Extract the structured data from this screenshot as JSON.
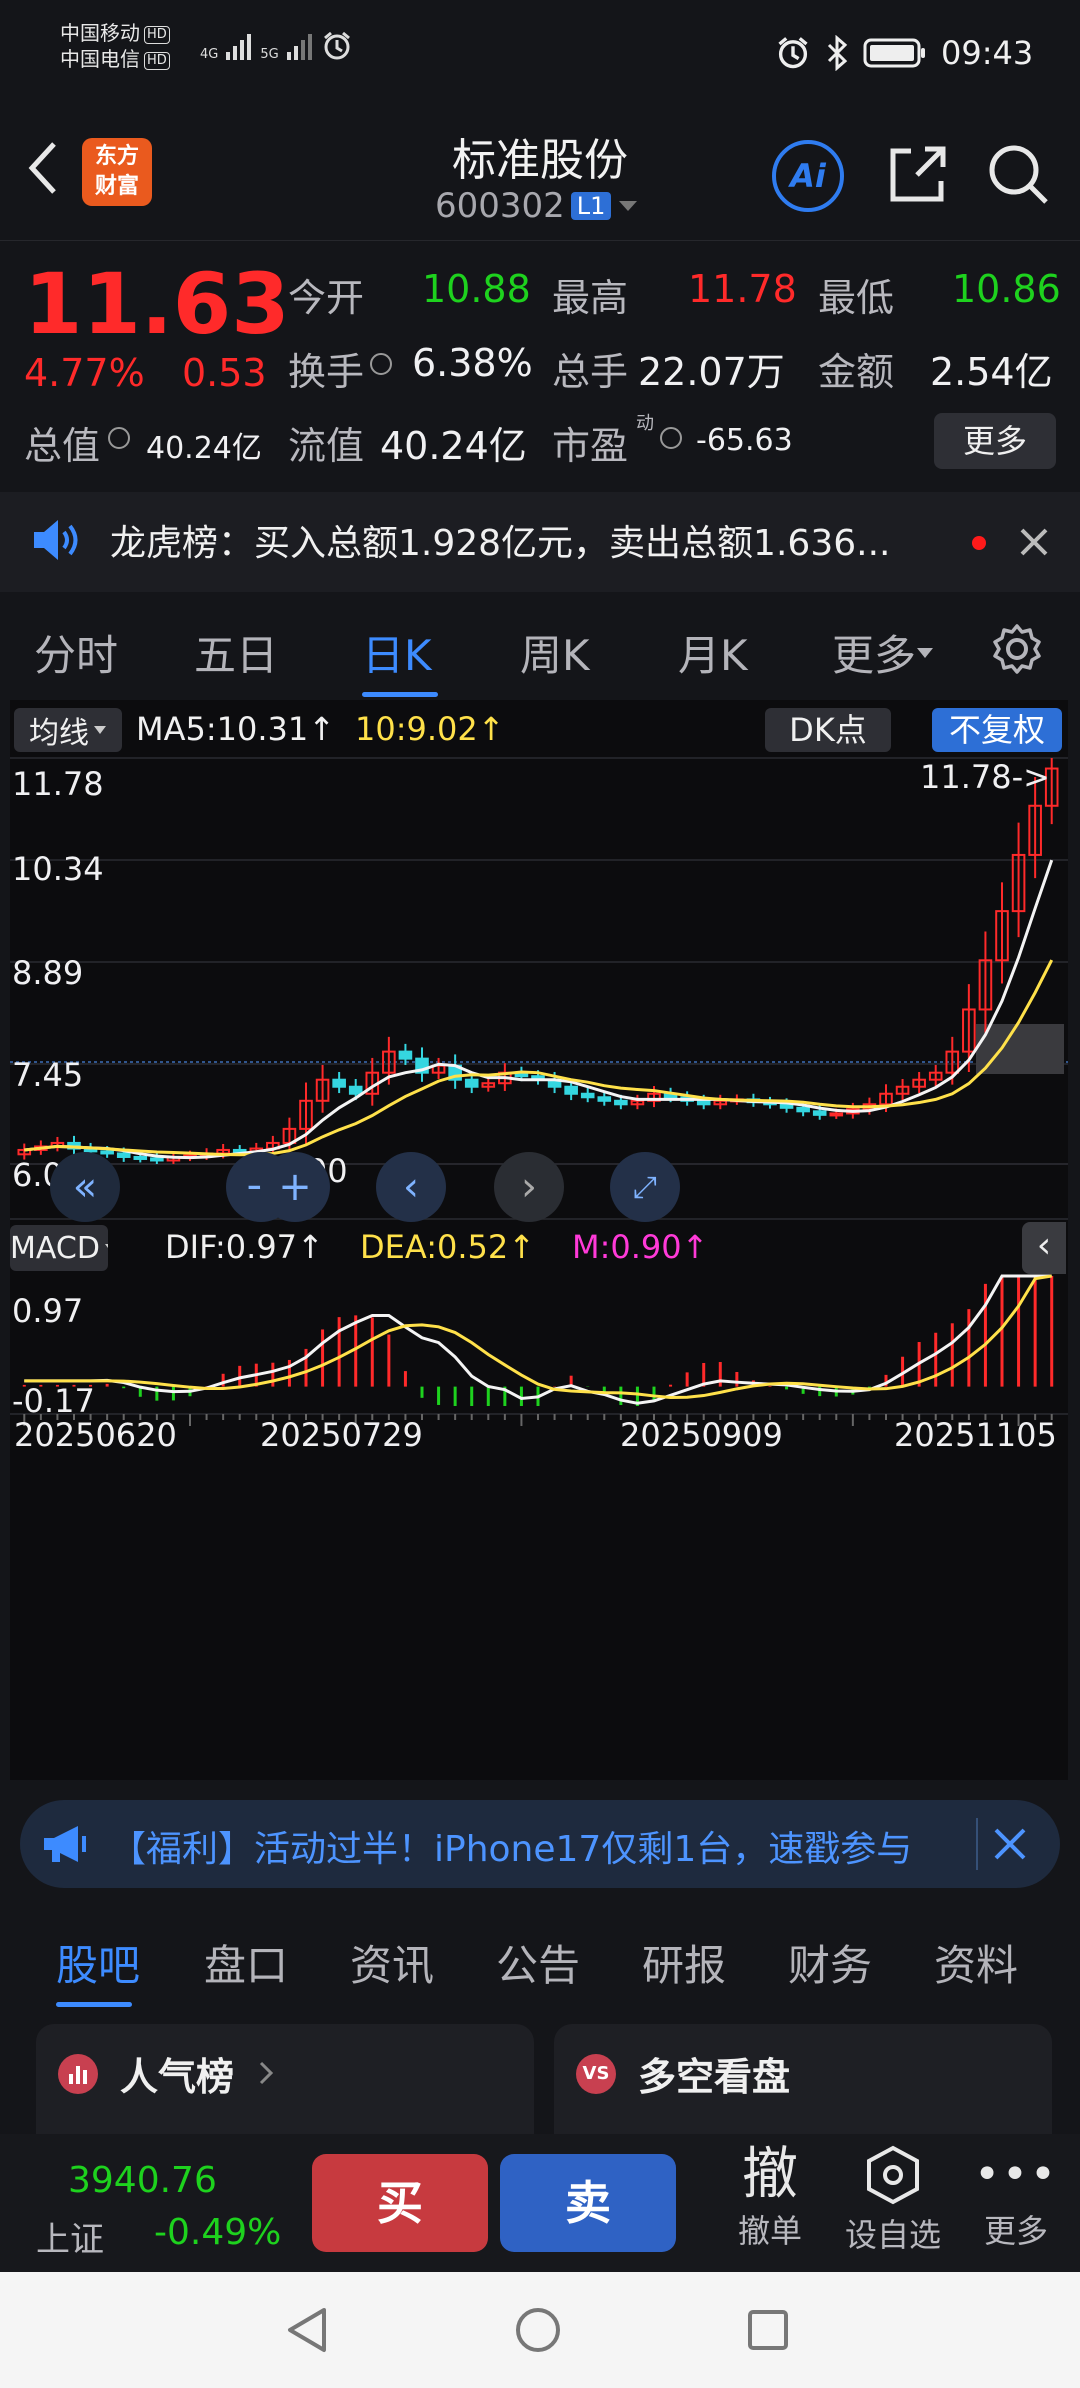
{
  "status": {
    "carrier1": "中国移动",
    "carrier2": "中国电信",
    "hd": "HD",
    "sig1": "4G",
    "sig2": "5G",
    "time": "09:43"
  },
  "header": {
    "brand_line1": "东方",
    "brand_line2": "财富",
    "stock_name": "标准股份",
    "stock_code": "600302",
    "level": "L1",
    "ai": "Ai"
  },
  "quote": {
    "price": "11.63",
    "change_pct": "4.77%",
    "change": "0.53",
    "open_label": "今开",
    "open": "10.88",
    "high_label": "最高",
    "high": "11.78",
    "low_label": "最低",
    "low": "10.86",
    "turnover_label": "换手",
    "turnover": "6.38%",
    "volume_label": "总手",
    "volume": "22.07万",
    "amount_label": "金额",
    "amount": "2.54亿",
    "mktcap_label": "总值",
    "mktcap": "40.24亿",
    "float_label": "流值",
    "float": "40.24亿",
    "pe_label": "市盈",
    "pe_sup": "动",
    "pe": "-65.63",
    "more": "更多"
  },
  "notice": {
    "text": "龙虎榜：买入总额1.928亿元，卖出总额1.636..."
  },
  "tabs": [
    "分时",
    "五日",
    "日K",
    "周K",
    "月K",
    "更多"
  ],
  "chart": {
    "ma_toggle": "均线",
    "ma5": "MA5:10.31",
    "ma10": "10:9.02",
    "dk": "DK点",
    "adjust": "不复权",
    "y_labels": [
      "11.78",
      "10.34",
      "8.89",
      "7.45",
      "6.00"
    ],
    "high_marker": "11.78->",
    "low_marker": "6.00",
    "macd_toggle": "MACD",
    "dif": "DIF:0.97",
    "dea": "DEA:0.52",
    "m": "M:0.90",
    "macd_high": "0.97",
    "macd_low": "-0.17",
    "dates": [
      "20250620",
      "20250729",
      "20250909",
      "20251105"
    ]
  },
  "chart_data": {
    "type": "candlestick",
    "y_range": [
      6.0,
      11.78
    ],
    "x_range": [
      "20250620",
      "20251105"
    ],
    "last_close": 11.63,
    "ma5": 10.31,
    "ma10": 9.02,
    "macd": {
      "dif": 0.97,
      "dea": 0.52,
      "m": 0.9,
      "range": [
        -0.17,
        0.97
      ]
    },
    "close_series": [
      6.2,
      6.25,
      6.3,
      6.22,
      6.18,
      6.15,
      6.1,
      6.08,
      6.05,
      6.1,
      6.12,
      6.15,
      6.2,
      6.18,
      6.22,
      6.3,
      6.5,
      6.9,
      7.2,
      7.1,
      7.0,
      7.3,
      7.6,
      7.5,
      7.3,
      7.4,
      7.2,
      7.1,
      7.15,
      7.3,
      7.25,
      7.2,
      7.1,
      7.0,
      6.95,
      6.9,
      6.85,
      6.9,
      7.0,
      6.95,
      6.9,
      6.85,
      6.9,
      6.92,
      6.88,
      6.85,
      6.8,
      6.75,
      6.7,
      6.72,
      6.78,
      6.85,
      7.0,
      7.1,
      7.2,
      7.3,
      7.6,
      8.2,
      8.9,
      9.6,
      10.4,
      11.1,
      11.63
    ]
  },
  "ad": {
    "text": "【福利】活动过半！iPhone17仅剩1台，速戳参与"
  },
  "info_tabs": [
    "股吧",
    "盘口",
    "资讯",
    "公告",
    "研报",
    "财务",
    "资料"
  ],
  "cards": {
    "popular": "人气榜",
    "vs_badge": "VS",
    "longshort": "多空看盘"
  },
  "bottom": {
    "index_value": "3940.76",
    "index_name": "上证",
    "index_change": "-0.49%",
    "buy": "买",
    "sell": "卖",
    "cancel_icon": "撤",
    "cancel": "撤单",
    "watch": "设自选",
    "more": "更多"
  },
  "colors": {
    "up": "#ff2a2a",
    "down": "#1ed21e",
    "accent": "#3d8bff"
  }
}
